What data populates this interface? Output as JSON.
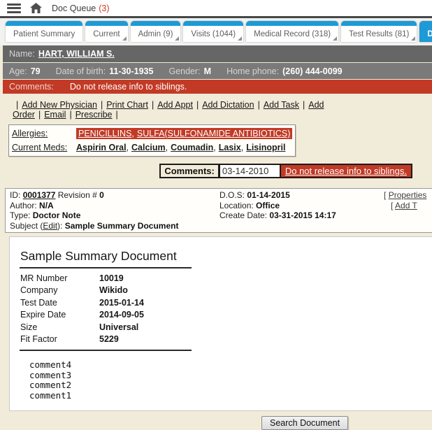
{
  "topbar": {
    "title": "Doc Queue",
    "count": "(3)",
    "icons": {
      "menu": "hamburger-bars",
      "home": "house"
    }
  },
  "tabs": [
    {
      "label": "Patient Summary"
    },
    {
      "label": "Current"
    },
    {
      "label": "Admin (9)"
    },
    {
      "label": "Visits (1044)"
    },
    {
      "label": "Medical Record (318)"
    },
    {
      "label": "Test Results (81)"
    },
    {
      "label": "Document S"
    }
  ],
  "patient": {
    "name_label": "Name:",
    "name": "HART, WILLIAM S.",
    "age_label": "Age:",
    "age": "79",
    "dob_label": "Date of birth:",
    "dob": "11-30-1935",
    "gender_label": "Gender:",
    "gender": "M",
    "phone_label": "Home phone:",
    "phone": "(260) 444-0099",
    "alert_label": "Comments:",
    "alert_text": "Do not release info to siblings."
  },
  "action_links": {
    "separator": "|",
    "items": [
      "Add New Physician",
      "Print Chart",
      "Add Appt",
      "Add Dictation",
      "Add Task",
      "Add Order",
      "Email",
      "Prescribe"
    ]
  },
  "allergy_panel": {
    "allergies_label": "Allergies:",
    "allergies": [
      "PENICILLINS",
      "SULFA(SULFONAMIDE ANTIBIOTICS)"
    ],
    "meds_label": "Current Meds:",
    "meds": [
      "Aspirin Oral",
      "Calcium",
      "Coumadin",
      "Lasix",
      "Lisinopril"
    ],
    "separator": ","
  },
  "comments_bar": {
    "label": "Comments:",
    "date_value": "03-14-2010",
    "note": "Do not release info to siblings."
  },
  "document_meta": {
    "id_label": "ID:",
    "id": "0001377",
    "revision_label": "Revision #",
    "revision": "0",
    "author_label": "Author:",
    "author": "N/A",
    "type_label": "Type:",
    "type": "Doctor Note",
    "subject_label_start": "Subject (",
    "subject_edit": "Edit",
    "subject_label_end": "):",
    "subject": "Sample Summary Document",
    "dos_label": "D.O.S:",
    "dos": "01-14-2015",
    "location_label": "Location:",
    "location": "Office",
    "create_label": "Create Date:",
    "create_date": "03-31-2015 14:17",
    "bracket": "[",
    "properties_link": "Properties",
    "add_link": "Add T"
  },
  "document": {
    "title": "Sample Summary Document",
    "fields": [
      {
        "label": "MR Number",
        "value": "10019"
      },
      {
        "label": "Company",
        "value": "Wikido"
      },
      {
        "label": "Test Date",
        "value": "2015-01-14"
      },
      {
        "label": "Expire Date",
        "value": "2014-09-05"
      },
      {
        "label": "Size",
        "value": "Universal"
      },
      {
        "label": "Fit Factor",
        "value": "5229"
      }
    ],
    "comments": [
      "comment4",
      "comment3",
      "comment2",
      "comment1"
    ]
  },
  "footer": {
    "search_button": "Search Document"
  },
  "colors": {
    "accent_blue": "#1e9ad6",
    "alert_red": "#c23a25",
    "page_beige": "#f1ebd9",
    "bar_gray": "#6b6b6b"
  }
}
